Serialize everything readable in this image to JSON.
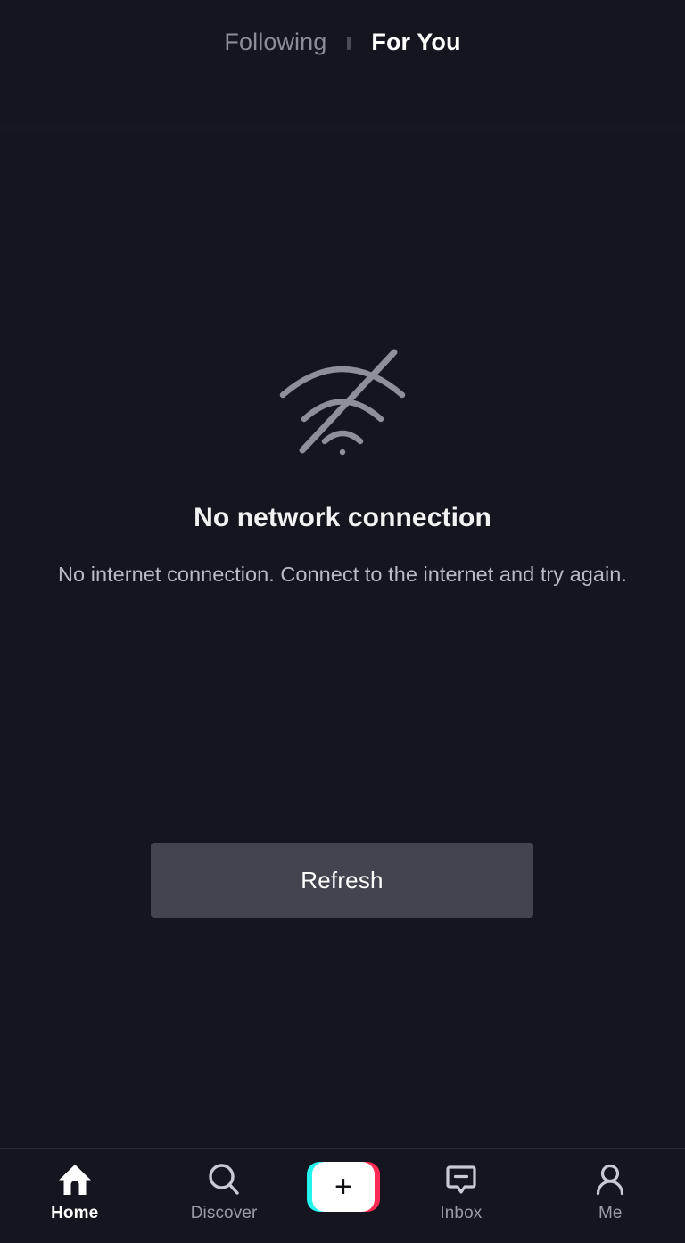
{
  "header": {
    "tabs": [
      {
        "label": "Following",
        "active": false
      },
      {
        "label": "For You",
        "active": true
      }
    ],
    "separator": "vertical-bar"
  },
  "empty_state": {
    "icon": "wifi-off-icon",
    "title": "No network connection",
    "description": "No internet connection. Connect to the internet and try again.",
    "action_label": "Refresh"
  },
  "bottom_nav": {
    "items": [
      {
        "label": "Home",
        "icon": "home-icon",
        "active": true
      },
      {
        "label": "Discover",
        "icon": "search-icon",
        "active": false
      },
      {
        "label": "Inbox",
        "icon": "inbox-icon",
        "active": false
      },
      {
        "label": "Me",
        "icon": "person-icon",
        "active": false
      }
    ],
    "create_button": {
      "icon": "plus-icon",
      "glyph": "+"
    }
  },
  "colors": {
    "background": "#14151e",
    "icon_gray": "#8d8f99",
    "text_primary": "#f2f2f4",
    "text_secondary": "#b9bac2",
    "button_bg": "#434450",
    "accent_cyan": "#25f4ee",
    "accent_pink": "#fe2c55",
    "nav_border": "#272836"
  }
}
